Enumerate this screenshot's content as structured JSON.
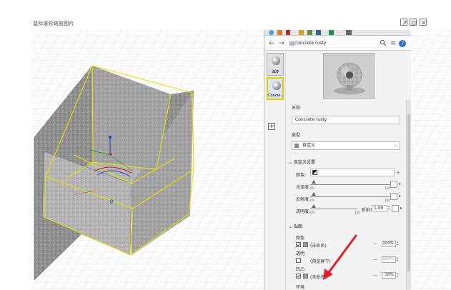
{
  "window": {
    "hint": "鼠标滚轮缩放图片"
  },
  "panel": {
    "breadcrumb_name": "Concrete rusty",
    "thumbnails": [
      {
        "label": "油漆"
      },
      {
        "label": "Concre..."
      }
    ],
    "name_label": "名称",
    "name_value": "Concrete rusty",
    "type_label": "类型",
    "type_value": "自定义",
    "custom_section": "自定义设置",
    "color_label": "颜色:",
    "gloss_label": "光泽度:",
    "reflect_label": "反射度:",
    "transparency_label": "透明度:",
    "slider_min": "0%",
    "slider_max": "100",
    "refraction_label": "折射率",
    "refraction_value": "1.00",
    "maps_section": "贴图",
    "map_color_label": "颜色",
    "map_color_value": "(未命名)",
    "map_color_pct": "100%",
    "map_transparency_label": "透明",
    "map_transparency_value": "(预览屏下)",
    "map_transparency_pct": "100%",
    "map_bump_label": "凹凸",
    "map_bump_value": "(未命名)",
    "map_bump_pct": "30%",
    "map_env_label": "环境"
  },
  "colors": {
    "selection": "#e8e000",
    "annotation_arrow": "#e41e26",
    "axis_blue": "#1f3fd0",
    "axis_green": "#1aa81a",
    "axis_red": "#d01a1a"
  }
}
